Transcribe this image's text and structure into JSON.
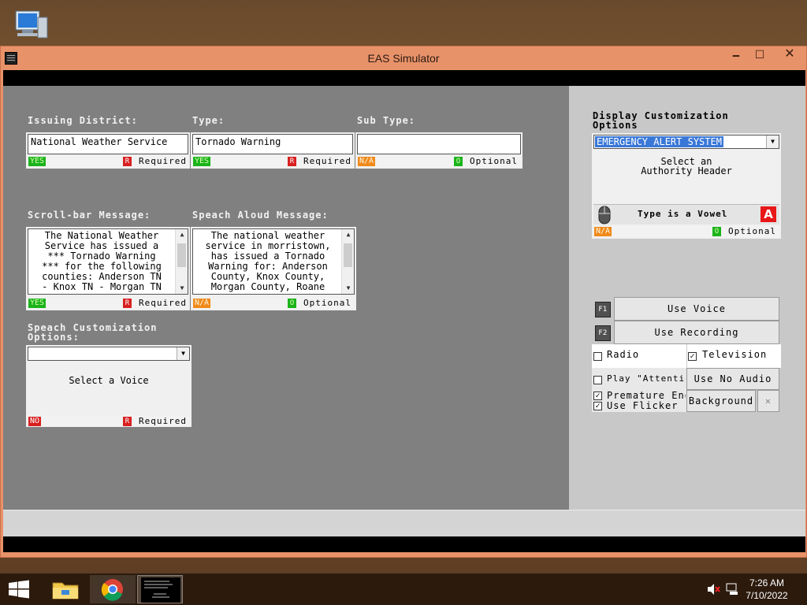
{
  "window": {
    "title": "EAS Simulator",
    "min_glyph": "🗕",
    "max_glyph": "☐",
    "close_glyph": "✕"
  },
  "form": {
    "issuing_district": {
      "label": "Issuing District:",
      "value": "National Weather Service",
      "status": "YES",
      "flag": "R",
      "requirement": "Required"
    },
    "type": {
      "label": "Type:",
      "value": "Tornado Warning",
      "status": "YES",
      "flag": "R",
      "requirement": "Required"
    },
    "sub_type": {
      "label": "Sub Type:",
      "value": "",
      "status": "N/A",
      "flag": "O",
      "requirement": "Optional"
    },
    "scroll_bar_message": {
      "label": "Scroll-bar Message:",
      "lines": [
        "The National Weather",
        "Service has issued a",
        "*** Tornado Warning",
        "*** for the following",
        "counties: Anderson TN",
        "- Knox TN - Morgan TN"
      ],
      "status": "YES",
      "flag": "R",
      "requirement": "Required"
    },
    "speech_aloud_message": {
      "label": "Speach Aloud Message:",
      "lines": [
        "The national weather",
        "service in morristown,",
        "has issued a Tornado",
        "Warning for: Anderson",
        "County, Knox County,",
        "Morgan County, Roane"
      ],
      "status": "N/A",
      "flag": "O",
      "requirement": "Optional"
    },
    "speech_customization": {
      "label_line1": "Speach Customization",
      "label_line2": "Options:",
      "selected": "",
      "placeholder": "Select a Voice",
      "status": "NO",
      "flag": "R",
      "requirement": "Required"
    }
  },
  "display_customization": {
    "label_line1": "Display Customization",
    "label_line2": "Options",
    "selected": "EMERGENCY ALERT SYSTEM",
    "placeholder_line1": "Select an",
    "placeholder_line2": "Authority Header",
    "icon_caption": "Type is a Vowel",
    "icon_letter": "A",
    "status": "N/A",
    "flag": "O",
    "requirement": "Optional"
  },
  "audio": {
    "f1_key": "F1",
    "use_voice": "Use Voice",
    "f2_key": "F2",
    "use_recording": "Use Recording",
    "radio": "Radio",
    "television": "Television",
    "play_attention": "Play \"Attention",
    "use_no_audio": "Use No Audio",
    "premature_end": "Premature End",
    "use_flicker": "Use Flicker",
    "background": "Background",
    "clear_glyph": "✕",
    "radio_checked": false,
    "television_checked": true,
    "play_attention_checked": false,
    "premature_end_checked": true,
    "use_flicker_checked": true
  },
  "taskbar": {
    "time": "7:26 AM",
    "date": "7/10/2022"
  },
  "colors": {
    "window_frame": "#e8926a",
    "form_background": "#808080",
    "status_green": "#1bb31b",
    "status_orange": "#f08a1a",
    "status_red": "#d82020",
    "selection_blue": "#3a78d8"
  }
}
